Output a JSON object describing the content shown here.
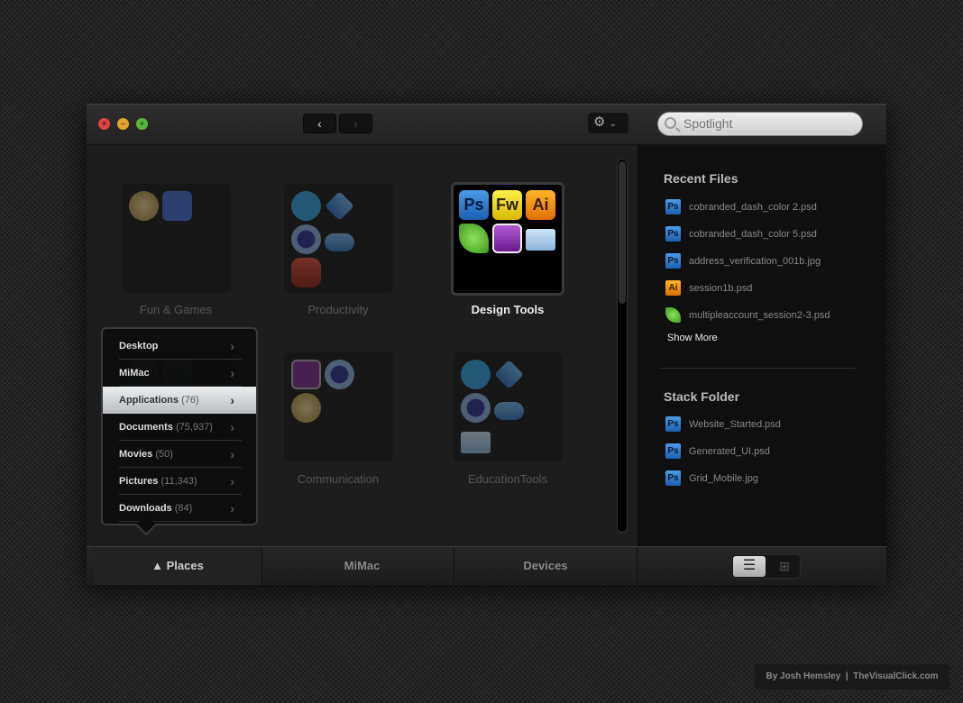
{
  "toolbar": {
    "back_icon": "chevron-left-icon",
    "forward_icon": "chevron-right-icon",
    "gear_icon": "gear-icon",
    "search_placeholder": "Spotlight"
  },
  "folders": [
    {
      "label": "Fun & Games",
      "state": "dim",
      "icons": [
        "ball-icon",
        "app-icon"
      ]
    },
    {
      "label": "Productivity",
      "state": "dim",
      "icons": [
        "skype-icon",
        "dropbox-icon",
        "drop-icon",
        "cloud-icon",
        "firecan-icon"
      ]
    },
    {
      "label": "Design Tools",
      "state": "selected",
      "icons": [
        "Ps",
        "Fw",
        "Ai",
        "coda-leaf-icon",
        "dashcode-icon",
        "folder-icon"
      ]
    },
    {
      "label": "",
      "state": "dim",
      "icons": [
        "Ps",
        "Ps"
      ]
    },
    {
      "label": "Communication",
      "state": "dim",
      "icons": [
        "purple-app-icon",
        "drop-icon",
        "ball-icon"
      ]
    },
    {
      "label": "EducationTools",
      "state": "dim",
      "icons": [
        "skype-icon",
        "dropbox-icon",
        "drop-icon",
        "cloud-icon",
        "folder-icon"
      ]
    }
  ],
  "places_menu": [
    {
      "label": "Desktop",
      "count": ""
    },
    {
      "label": "MiMac",
      "count": ""
    },
    {
      "label": "Applications",
      "count": "(76)",
      "active": true
    },
    {
      "label": "Documents",
      "count": "(75,937)"
    },
    {
      "label": "Movies",
      "count": "(50)"
    },
    {
      "label": "Pictures",
      "count": "(11,343)"
    },
    {
      "label": "Downloads",
      "count": "(84)"
    }
  ],
  "recent": {
    "title": "Recent Files",
    "files": [
      {
        "name": "cobranded_dash_color 2.psd",
        "icon": "Ps"
      },
      {
        "name": "cobranded_dash_color 5.psd",
        "icon": "Ps"
      },
      {
        "name": "address_verification_001b.jpg",
        "icon": "Ps"
      },
      {
        "name": "session1b.psd",
        "icon": "Ai"
      },
      {
        "name": "multipleaccount_session2-3.psd",
        "icon": "leaf"
      }
    ],
    "show_more": "Show More"
  },
  "stack": {
    "title": "Stack Folder",
    "files": [
      {
        "name": "Website_Started.psd",
        "icon": "Ps"
      },
      {
        "name": "Generated_UI.psd",
        "icon": "Ps"
      },
      {
        "name": "Grid_Mobile.jpg",
        "icon": "Ps"
      }
    ]
  },
  "bottom_tabs": [
    "Places",
    "MiMac",
    "Devices"
  ],
  "view": {
    "selected": "list"
  },
  "credit": {
    "author": "By Josh Hemsley",
    "site": "TheVisualClick.com"
  }
}
